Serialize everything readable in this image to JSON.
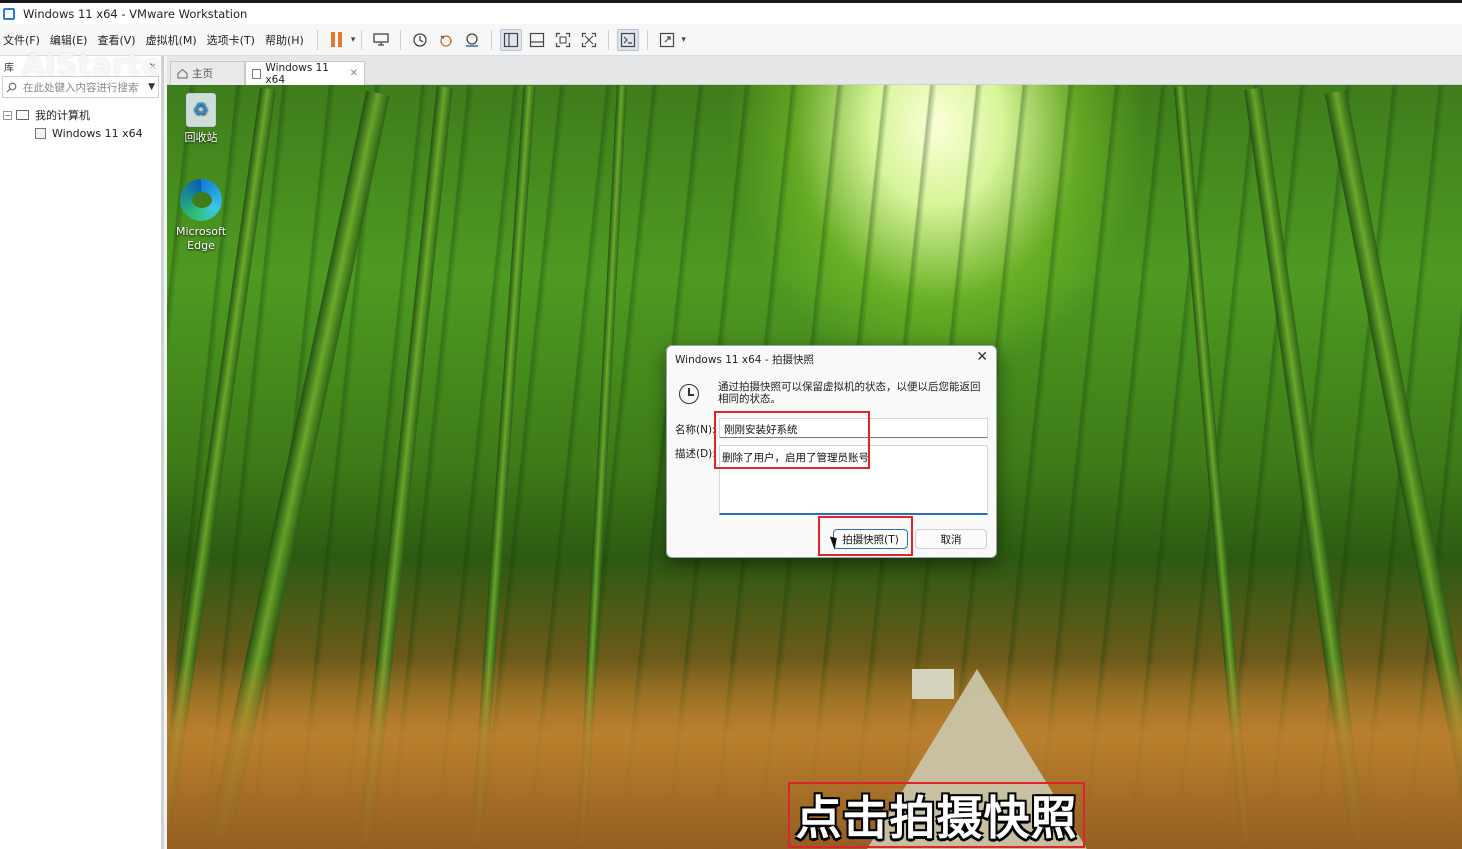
{
  "window": {
    "title": "Windows 11 x64 - VMware Workstation"
  },
  "menu": [
    "文件(F)",
    "编辑(E)",
    "查看(V)",
    "虚拟机(M)",
    "选项卡(T)",
    "帮助(H)"
  ],
  "toolbar": {
    "icons": [
      "pause-icon",
      "send-ctrl-alt-del-icon",
      "snapshot-take-icon",
      "snapshot-revert-icon",
      "snapshot-manager-icon",
      "library-view-icon",
      "thumbnail-bar-icon",
      "fullscreen-icon",
      "unity-icon",
      "console-view-icon",
      "stretch-icon"
    ]
  },
  "library": {
    "header": "库",
    "watermark": "AIStarter",
    "search_placeholder": "在此处键入内容进行搜索",
    "tree": [
      {
        "label": "我的计算机",
        "level": 0
      },
      {
        "label": "Windows 11 x64",
        "level": 1
      }
    ]
  },
  "tabs": [
    {
      "label": "主页"
    },
    {
      "label": "Windows 11 x64"
    }
  ],
  "desktop": {
    "icons": [
      {
        "label": "回收站"
      },
      {
        "label": "Microsoft Edge"
      }
    ]
  },
  "dialog": {
    "title": "Windows 11 x64 - 拍摄快照",
    "info": "通过拍摄快照可以保留虚拟机的状态，以便以后您能返回相同的状态。",
    "name_label": "名称(N):",
    "name_value": "刚刚安装好系统",
    "desc_label": "描述(D):",
    "desc_value": "删除了用户，启用了管理员账号",
    "snap_button": "拍摄快照(T)",
    "cancel_button": "取消"
  },
  "caption": "点击拍摄快照",
  "colors": {
    "highlight": "#e0242b",
    "accent": "#2a6fb0",
    "pause": "#e8772e"
  }
}
